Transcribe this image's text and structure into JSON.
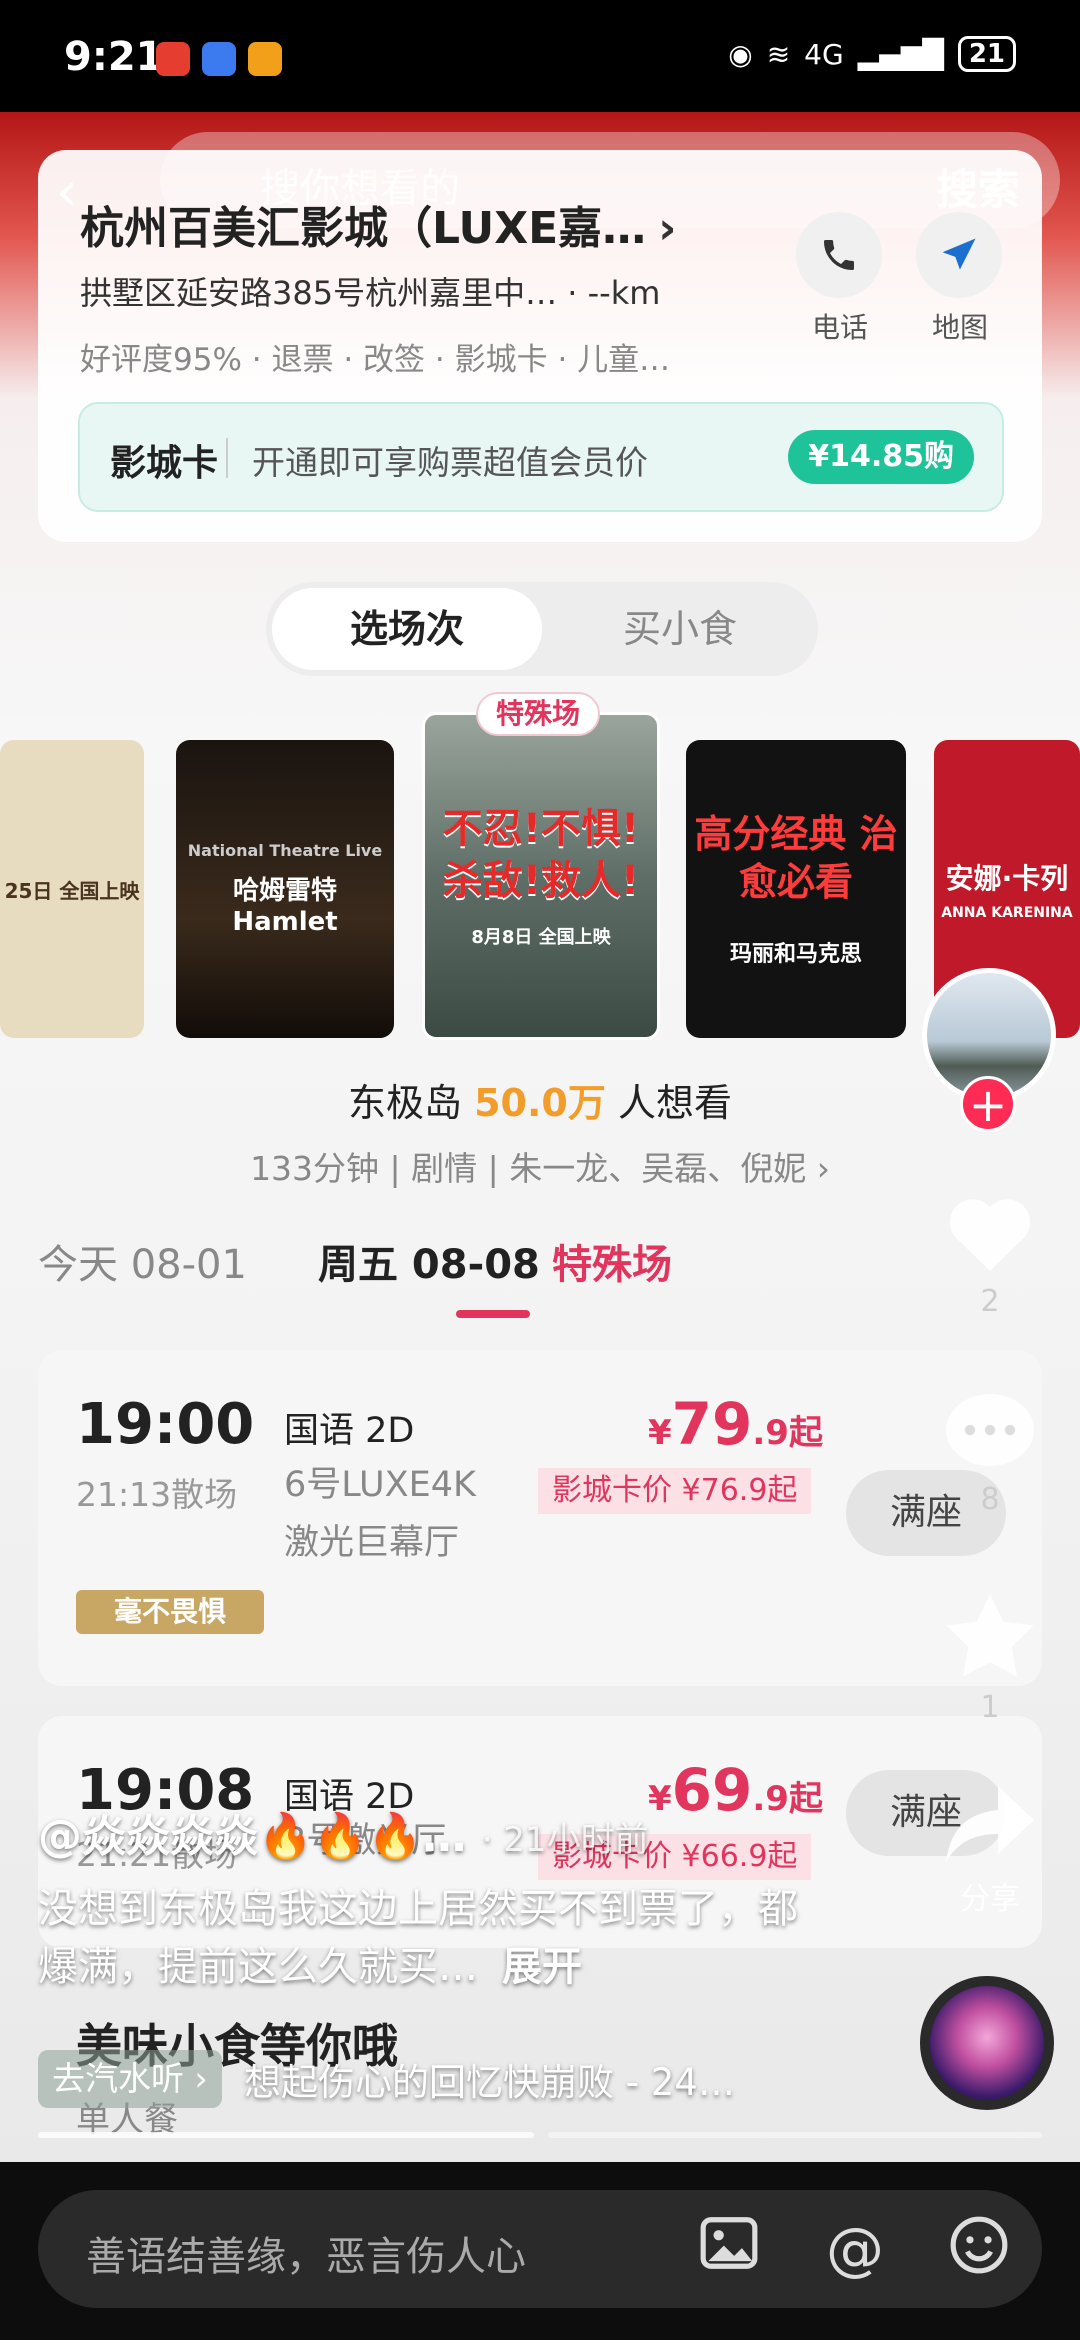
{
  "status_bar": {
    "time": "9:21",
    "battery": "21",
    "network": "4G"
  },
  "search": {
    "placeholder": "搜你想看的",
    "button": "搜索"
  },
  "cinema": {
    "name": "杭州百美汇影城（LUXE嘉…",
    "address": "拱墅区延安路385号杭州嘉里中…  · --km",
    "tags": "好评度95% · 退票 · 改签 · 影城卡 · 儿童…",
    "phone_label": "电话",
    "map_label": "地图"
  },
  "vip_card": {
    "name": "影城卡",
    "desc": "开通即可享购票超值会员价",
    "button": "¥14.85购"
  },
  "tabs": {
    "select_show": "选场次",
    "buy_snacks": "买小食"
  },
  "posters": [
    {
      "text": "25日 全国上映",
      "bg": "#e8dcc0"
    },
    {
      "text": "哈姆雷特 Hamlet",
      "sub": "National Theatre Live",
      "bg": "#3a2a1c"
    },
    {
      "text": "不忍!不惧! 杀敌!救人!",
      "sub": "8月8日 全国上映",
      "bg": "#6b7f78",
      "badge": "特殊场"
    },
    {
      "text": "高分经典 治愈必看",
      "sub": "玛丽和马克思",
      "bg": "#121212"
    },
    {
      "text": "安娜·卡列",
      "sub": "ANNA KARENINA",
      "bg": "#c01a2a"
    }
  ],
  "movie": {
    "name": "东极岛",
    "want_count": "50.0万",
    "want_suffix": "人想看",
    "info": "133分钟 | 剧情 | 朱一龙、吴磊、倪妮 ›"
  },
  "dates": {
    "today": "今天 08-01",
    "friday": "周五 08-08",
    "special": "特殊场"
  },
  "showtimes": [
    {
      "start": "19:00",
      "end": "21:13散场",
      "lang": "国语 2D",
      "hall1": "6号LUXE4K",
      "hall2": "激光巨幕厅",
      "price_symbol": "¥",
      "price_int": "79",
      "price_dec": ".9起",
      "card_price": "影城卡价 ¥76.9起",
      "status": "满座",
      "tag": "毫不畏惧"
    },
    {
      "start": "19:08",
      "end": "21:21散场",
      "lang": "国语 2D",
      "hall1": "3号激光厅",
      "hall2": "",
      "price_symbol": "¥",
      "price_int": "69",
      "price_dec": ".9起",
      "card_price": "影城卡价 ¥66.9起",
      "status": "满座",
      "tag": ""
    }
  ],
  "snacks": {
    "title": "美味小食等你哦",
    "sub": "单人餐"
  },
  "video": {
    "author": "@焱焱焱焱🔥🔥🔥…",
    "time_ago": "· 21小时前",
    "caption": "没想到东极岛我这边上居然买不到票了，都爆满，提前这么久就买…",
    "expand": "展开",
    "music_chip": "去汽水听 ›",
    "music": "想起伤心的回忆快崩败 - 24…",
    "likes": "2",
    "comments": "8",
    "favorites": "1",
    "share": "分享"
  },
  "comment_box": {
    "placeholder": "善语结善缘，恶言伤人心"
  },
  "colors": {
    "accent": "#e2355e",
    "teal": "#1fc39a",
    "want": "#f29c2a"
  }
}
